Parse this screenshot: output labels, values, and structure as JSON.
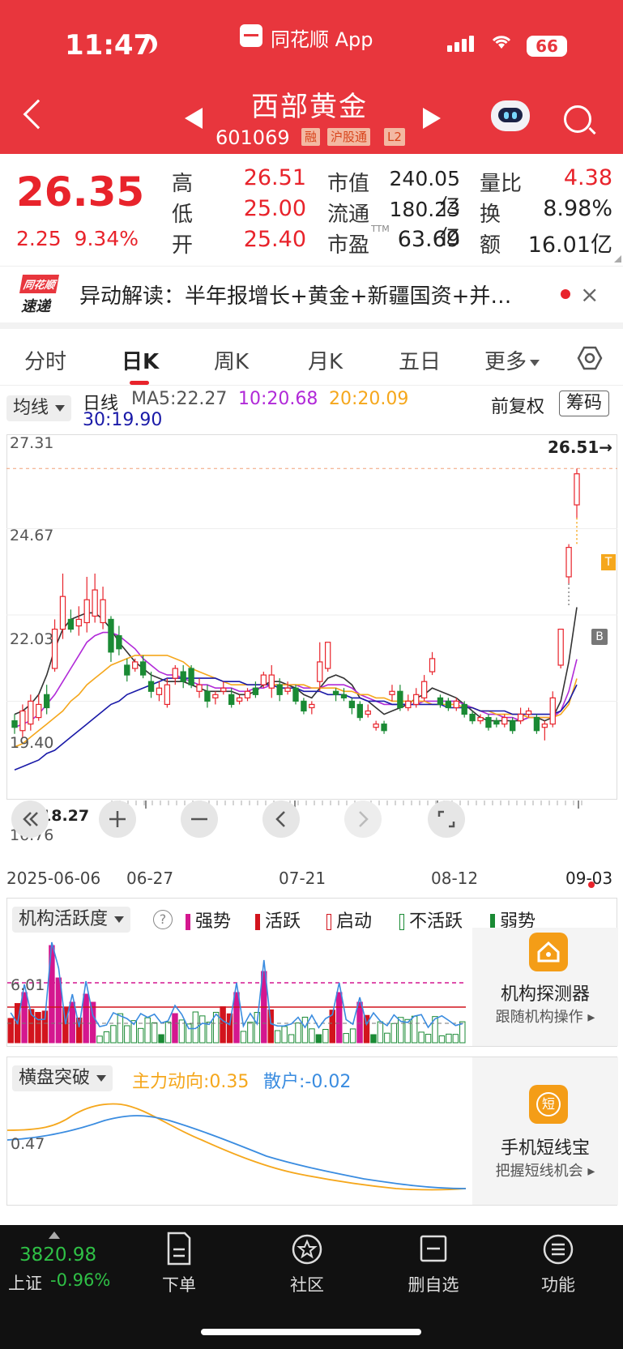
{
  "status_bar": {
    "time": "11:47",
    "app": "同花顺 App",
    "battery": "66"
  },
  "header": {
    "stock_name": "西部黄金",
    "stock_code": "601069",
    "tags": [
      "融",
      "沪股通",
      "L2"
    ]
  },
  "quote": {
    "price": "26.35",
    "change": "2.25",
    "change_pct": "9.34%",
    "rows": [
      {
        "l1": "高",
        "v1": "26.51",
        "l2": "市值",
        "v2": "240.05亿",
        "l3": "量比",
        "v3": "4.38"
      },
      {
        "l1": "低",
        "v1": "25.00",
        "l2": "流通",
        "v2": "180.23亿",
        "l3": "换",
        "v3": "8.98%"
      },
      {
        "l1": "开",
        "v1": "25.40",
        "l2": "市盈",
        "v2": "63.69",
        "l3": "额",
        "v3": "16.01亿"
      }
    ],
    "ttm": "TTM"
  },
  "news": {
    "logo_top": "同花顺",
    "logo_bottom": "速递",
    "text": "异动解读：半年报增长+黄金+新疆国资+并…"
  },
  "tabs": [
    "分时",
    "日K",
    "周K",
    "月K",
    "五日",
    "更多"
  ],
  "ma_bar": {
    "selector": "均线",
    "period": "日线",
    "ma5": "MA5:22.27",
    "ma10": "10:20.68",
    "ma20": "20:20.09",
    "ma30": "30:19.90",
    "adjust": "前复权",
    "chips": "筹码"
  },
  "kchart_labels": {
    "y_ticks": [
      "27.31",
      "24.67",
      "22.03",
      "19.40",
      "16.76"
    ],
    "high_marker": "26.51→",
    "low_marker": "18.27",
    "marker_t": "T",
    "marker_b": "B",
    "dates": [
      "2025-06-06",
      "06-27",
      "07-21",
      "08-12",
      "09-03"
    ]
  },
  "chart_data": {
    "type": "candlestick",
    "title": "",
    "ylim": [
      16.76,
      27.31
    ],
    "x_ticks": [
      "2025-06-06",
      "06-27",
      "07-21",
      "08-12",
      "09-03"
    ],
    "y_ticks": [
      27.31,
      24.67,
      22.03,
      19.4,
      16.76
    ],
    "candles": [
      {
        "o": 18.8,
        "c": 18.6,
        "h": 19.0,
        "l": 18.4
      },
      {
        "o": 18.5,
        "c": 19.1,
        "h": 19.3,
        "l": 18.27
      },
      {
        "o": 18.7,
        "c": 19.4,
        "h": 19.6,
        "l": 18.5
      },
      {
        "o": 18.9,
        "c": 19.3,
        "h": 19.6,
        "l": 18.8
      },
      {
        "o": 19.6,
        "c": 19.2,
        "h": 19.9,
        "l": 19.0
      },
      {
        "o": 20.4,
        "c": 21.6,
        "h": 21.9,
        "l": 20.3
      },
      {
        "o": 21.6,
        "c": 22.6,
        "h": 23.3,
        "l": 21.3
      },
      {
        "o": 21.9,
        "c": 21.6,
        "h": 22.2,
        "l": 21.5
      },
      {
        "o": 21.7,
        "c": 21.9,
        "h": 22.3,
        "l": 21.4
      },
      {
        "o": 21.8,
        "c": 22.5,
        "h": 23.2,
        "l": 21.5
      },
      {
        "o": 22.0,
        "c": 22.8,
        "h": 23.3,
        "l": 21.8
      },
      {
        "o": 21.8,
        "c": 22.5,
        "h": 22.9,
        "l": 21.6
      },
      {
        "o": 21.9,
        "c": 20.9,
        "h": 22.0,
        "l": 20.6
      },
      {
        "o": 21.4,
        "c": 21.0,
        "h": 21.7,
        "l": 20.8
      },
      {
        "o": 20.5,
        "c": 20.2,
        "h": 20.7,
        "l": 20.0
      },
      {
        "o": 20.4,
        "c": 20.6,
        "h": 20.7,
        "l": 20.3
      },
      {
        "o": 20.6,
        "c": 20.2,
        "h": 20.8,
        "l": 20.1
      },
      {
        "o": 20.0,
        "c": 19.7,
        "h": 20.3,
        "l": 19.5
      },
      {
        "o": 19.6,
        "c": 19.8,
        "h": 20.0,
        "l": 19.4
      },
      {
        "o": 19.3,
        "c": 19.9,
        "h": 20.1,
        "l": 19.2
      },
      {
        "o": 20.1,
        "c": 20.4,
        "h": 20.5,
        "l": 19.9
      },
      {
        "o": 20.3,
        "c": 20.0,
        "h": 20.5,
        "l": 19.8
      },
      {
        "o": 20.4,
        "c": 19.9,
        "h": 20.5,
        "l": 19.8
      },
      {
        "o": 19.7,
        "c": 19.9,
        "h": 20.1,
        "l": 19.5
      },
      {
        "o": 19.7,
        "c": 19.4,
        "h": 19.9,
        "l": 19.2
      },
      {
        "o": 19.5,
        "c": 19.6,
        "h": 19.7,
        "l": 19.3
      },
      {
        "o": 19.7,
        "c": 19.8,
        "h": 20.0,
        "l": 19.6
      },
      {
        "o": 19.6,
        "c": 19.3,
        "h": 19.8,
        "l": 19.2
      },
      {
        "o": 19.4,
        "c": 19.5,
        "h": 19.6,
        "l": 19.3
      },
      {
        "o": 19.5,
        "c": 19.7,
        "h": 19.8,
        "l": 19.4
      },
      {
        "o": 19.8,
        "c": 19.6,
        "h": 20.0,
        "l": 19.5
      },
      {
        "o": 19.9,
        "c": 20.2,
        "h": 20.3,
        "l": 19.8
      },
      {
        "o": 19.8,
        "c": 20.2,
        "h": 20.5,
        "l": 19.5
      },
      {
        "o": 19.9,
        "c": 19.6,
        "h": 20.1,
        "l": 19.4
      },
      {
        "o": 19.7,
        "c": 19.8,
        "h": 20.0,
        "l": 19.6
      },
      {
        "o": 19.8,
        "c": 19.4,
        "h": 19.9,
        "l": 19.3
      },
      {
        "o": 19.4,
        "c": 19.1,
        "h": 19.5,
        "l": 19.0
      },
      {
        "o": 19.2,
        "c": 19.3,
        "h": 19.4,
        "l": 19.0
      },
      {
        "o": 20.0,
        "c": 20.6,
        "h": 21.2,
        "l": 19.7
      },
      {
        "o": 20.4,
        "c": 21.2,
        "h": 21.2,
        "l": 20.3
      },
      {
        "o": 19.7,
        "c": 19.6,
        "h": 19.8,
        "l": 19.4
      },
      {
        "o": 19.6,
        "c": 19.5,
        "h": 19.8,
        "l": 19.4
      },
      {
        "o": 19.4,
        "c": 19.2,
        "h": 19.5,
        "l": 19.0
      },
      {
        "o": 19.3,
        "c": 18.9,
        "h": 19.4,
        "l": 18.8
      },
      {
        "o": 19.0,
        "c": 19.1,
        "h": 19.3,
        "l": 18.9
      },
      {
        "o": 18.6,
        "c": 18.7,
        "h": 18.8,
        "l": 18.5
      },
      {
        "o": 18.7,
        "c": 18.5,
        "h": 18.8,
        "l": 18.4
      },
      {
        "o": 19.6,
        "c": 19.7,
        "h": 19.9,
        "l": 19.4
      },
      {
        "o": 19.7,
        "c": 19.2,
        "h": 19.9,
        "l": 19.1
      },
      {
        "o": 19.2,
        "c": 19.4,
        "h": 19.6,
        "l": 19.1
      },
      {
        "o": 19.3,
        "c": 19.6,
        "h": 19.8,
        "l": 19.2
      },
      {
        "o": 19.5,
        "c": 20.0,
        "h": 20.2,
        "l": 19.4
      },
      {
        "o": 20.3,
        "c": 20.7,
        "h": 20.9,
        "l": 20.2
      },
      {
        "o": 19.5,
        "c": 19.3,
        "h": 19.6,
        "l": 19.2
      },
      {
        "o": 19.4,
        "c": 19.2,
        "h": 19.5,
        "l": 19.1
      },
      {
        "o": 19.2,
        "c": 19.4,
        "h": 19.5,
        "l": 19.1
      },
      {
        "o": 19.3,
        "c": 19.0,
        "h": 19.4,
        "l": 18.9
      },
      {
        "o": 19.0,
        "c": 18.8,
        "h": 19.1,
        "l": 18.7
      },
      {
        "o": 18.8,
        "c": 18.9,
        "h": 19.0,
        "l": 18.7
      },
      {
        "o": 18.9,
        "c": 18.6,
        "h": 19.0,
        "l": 18.5
      },
      {
        "o": 18.8,
        "c": 18.7,
        "h": 18.9,
        "l": 18.6
      },
      {
        "o": 18.7,
        "c": 18.9,
        "h": 19.0,
        "l": 18.6
      },
      {
        "o": 18.8,
        "c": 18.5,
        "h": 18.9,
        "l": 18.4
      },
      {
        "o": 18.8,
        "c": 19.0,
        "h": 19.2,
        "l": 18.7
      },
      {
        "o": 19.0,
        "c": 19.1,
        "h": 19.2,
        "l": 18.9
      },
      {
        "o": 18.9,
        "c": 18.5,
        "h": 19.0,
        "l": 18.4
      },
      {
        "o": 18.6,
        "c": 18.7,
        "h": 18.8,
        "l": 18.2
      },
      {
        "o": 18.7,
        "c": 19.5,
        "h": 19.7,
        "l": 18.6
      },
      {
        "o": 20.5,
        "c": 21.6,
        "h": 21.6,
        "l": 20.4
      },
      {
        "o": 23.2,
        "c": 24.1,
        "h": 24.2,
        "l": 23.0
      },
      {
        "o": 25.4,
        "c": 26.35,
        "h": 26.51,
        "l": 25.0
      }
    ],
    "series": [
      {
        "name": "MA5",
        "values": [
          19.0,
          19.1,
          19.3,
          19.6,
          20.2,
          21.0,
          21.6,
          21.9,
          22.0,
          22.1,
          22.1,
          21.9,
          21.6,
          21.2,
          20.9,
          20.6,
          20.4,
          20.2,
          20.1,
          20.0,
          20.0,
          20.0,
          19.9,
          19.8,
          19.7,
          19.7,
          19.7,
          19.7,
          19.6,
          19.6,
          19.7,
          19.9,
          20.0,
          20.0,
          19.9,
          19.8,
          19.6,
          19.5,
          19.8,
          20.1,
          20.2,
          20.1,
          19.9,
          19.5,
          19.4,
          19.2,
          19.0,
          19.1,
          19.2,
          19.3,
          19.5,
          19.6,
          19.8,
          19.7,
          19.6,
          19.5,
          19.3,
          19.1,
          18.9,
          18.8,
          18.8,
          18.8,
          18.8,
          18.8,
          18.9,
          18.9,
          18.8,
          18.9,
          19.4,
          20.6,
          22.27
        ]
      },
      {
        "name": "10",
        "values": [
          18.6,
          18.7,
          18.8,
          19.0,
          19.3,
          19.6,
          20.0,
          20.4,
          20.8,
          21.2,
          21.4,
          21.5,
          21.5,
          21.4,
          21.2,
          21.0,
          20.7,
          20.5,
          20.3,
          20.2,
          20.2,
          20.1,
          20.0,
          19.9,
          19.9,
          19.8,
          19.8,
          19.8,
          19.7,
          19.7,
          19.8,
          19.8,
          19.9,
          19.9,
          19.9,
          19.9,
          19.8,
          19.8,
          19.8,
          19.9,
          19.9,
          19.9,
          19.8,
          19.6,
          19.5,
          19.4,
          19.3,
          19.3,
          19.3,
          19.3,
          19.3,
          19.4,
          19.4,
          19.4,
          19.4,
          19.4,
          19.3,
          19.2,
          19.1,
          19.0,
          19.0,
          18.9,
          18.9,
          18.8,
          18.9,
          18.9,
          18.9,
          18.9,
          19.1,
          19.7,
          20.68
        ]
      },
      {
        "name": "20",
        "values": [
          18.0,
          18.1,
          18.3,
          18.5,
          18.7,
          18.9,
          19.1,
          19.4,
          19.6,
          19.9,
          20.1,
          20.3,
          20.5,
          20.6,
          20.7,
          20.8,
          20.8,
          20.8,
          20.8,
          20.8,
          20.7,
          20.6,
          20.4,
          20.3,
          20.2,
          20.1,
          20.0,
          19.9,
          19.9,
          19.9,
          19.9,
          19.9,
          19.9,
          19.9,
          19.9,
          19.9,
          19.9,
          19.8,
          19.8,
          19.8,
          19.8,
          19.7,
          19.7,
          19.6,
          19.6,
          19.5,
          19.5,
          19.4,
          19.4,
          19.4,
          19.4,
          19.4,
          19.3,
          19.3,
          19.3,
          19.3,
          19.2,
          19.2,
          19.1,
          19.1,
          19.0,
          19.0,
          19.0,
          19.0,
          18.9,
          18.9,
          18.9,
          18.9,
          19.0,
          19.3,
          20.09
        ]
      },
      {
        "name": "30",
        "values": [
          17.3,
          17.4,
          17.5,
          17.6,
          17.8,
          17.9,
          18.1,
          18.3,
          18.5,
          18.7,
          18.9,
          19.1,
          19.3,
          19.4,
          19.6,
          19.7,
          19.8,
          19.9,
          20.0,
          20.1,
          20.1,
          20.1,
          20.1,
          20.1,
          20.1,
          20.1,
          20.0,
          20.0,
          20.0,
          19.9,
          19.9,
          19.9,
          19.9,
          19.8,
          19.8,
          19.8,
          19.7,
          19.7,
          19.7,
          19.6,
          19.6,
          19.6,
          19.5,
          19.5,
          19.4,
          19.4,
          19.4,
          19.3,
          19.3,
          19.3,
          19.3,
          19.3,
          19.3,
          19.3,
          19.2,
          19.2,
          19.2,
          19.2,
          19.1,
          19.1,
          19.1,
          19.1,
          19.0,
          19.0,
          19.0,
          19.0,
          19.0,
          19.0,
          19.1,
          19.4,
          19.9
        ]
      }
    ]
  },
  "indicator1": {
    "selector": "机构活跃度",
    "help": "?",
    "legend": [
      "强势",
      "活跃",
      "启动",
      "不活跃",
      "弱势"
    ],
    "y_tick": "6.01",
    "promo_title": "机构探测器",
    "promo_sub": "跟随机构操作"
  },
  "indicator2": {
    "selector": "横盘突破",
    "main": "主力动向:0.35",
    "retail": "散户:-0.02",
    "y_tick": "0.47",
    "promo_icon": "短",
    "promo_title": "手机短线宝",
    "promo_sub": "把握短线机会"
  },
  "bottom_nav": {
    "index_value": "3820.98",
    "index_name": "上证",
    "index_change": "-0.96%",
    "items": [
      "下单",
      "社区",
      "删自选",
      "功能"
    ]
  },
  "colors": {
    "up": "#e8232b",
    "down": "#1a8a34",
    "header": "#e8363d",
    "ma5": "#333333",
    "ma10": "#b12ad8",
    "ma20": "#f5a71c",
    "ma30": "#1a1aa8"
  }
}
